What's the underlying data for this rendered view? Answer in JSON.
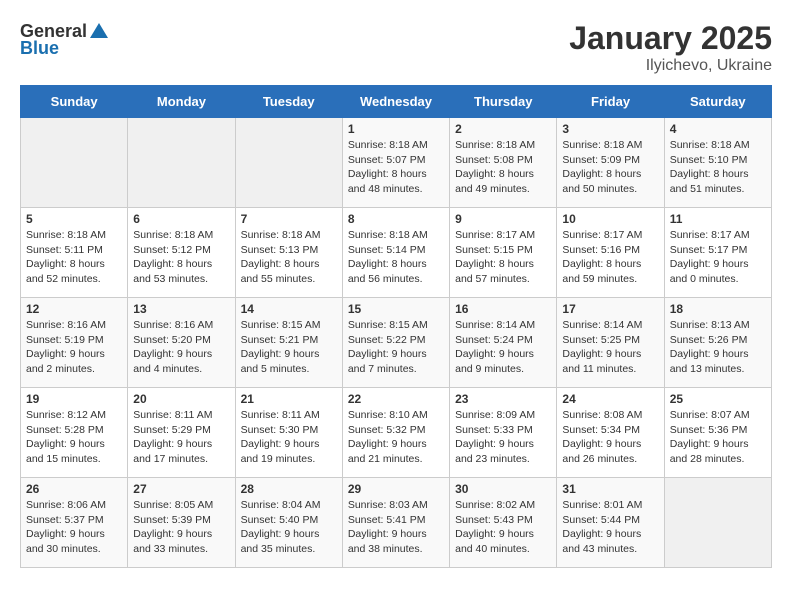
{
  "header": {
    "logo_general": "General",
    "logo_blue": "Blue",
    "title": "January 2025",
    "subtitle": "Ilyichevo, Ukraine"
  },
  "days_of_week": [
    "Sunday",
    "Monday",
    "Tuesday",
    "Wednesday",
    "Thursday",
    "Friday",
    "Saturday"
  ],
  "weeks": [
    [
      {
        "day": "",
        "empty": true
      },
      {
        "day": "",
        "empty": true
      },
      {
        "day": "",
        "empty": true
      },
      {
        "day": "1",
        "sunrise": "8:18 AM",
        "sunset": "5:07 PM",
        "daylight": "8 hours and 48 minutes."
      },
      {
        "day": "2",
        "sunrise": "8:18 AM",
        "sunset": "5:08 PM",
        "daylight": "8 hours and 49 minutes."
      },
      {
        "day": "3",
        "sunrise": "8:18 AM",
        "sunset": "5:09 PM",
        "daylight": "8 hours and 50 minutes."
      },
      {
        "day": "4",
        "sunrise": "8:18 AM",
        "sunset": "5:10 PM",
        "daylight": "8 hours and 51 minutes."
      }
    ],
    [
      {
        "day": "5",
        "sunrise": "8:18 AM",
        "sunset": "5:11 PM",
        "daylight": "8 hours and 52 minutes."
      },
      {
        "day": "6",
        "sunrise": "8:18 AM",
        "sunset": "5:12 PM",
        "daylight": "8 hours and 53 minutes."
      },
      {
        "day": "7",
        "sunrise": "8:18 AM",
        "sunset": "5:13 PM",
        "daylight": "8 hours and 55 minutes."
      },
      {
        "day": "8",
        "sunrise": "8:18 AM",
        "sunset": "5:14 PM",
        "daylight": "8 hours and 56 minutes."
      },
      {
        "day": "9",
        "sunrise": "8:17 AM",
        "sunset": "5:15 PM",
        "daylight": "8 hours and 57 minutes."
      },
      {
        "day": "10",
        "sunrise": "8:17 AM",
        "sunset": "5:16 PM",
        "daylight": "8 hours and 59 minutes."
      },
      {
        "day": "11",
        "sunrise": "8:17 AM",
        "sunset": "5:17 PM",
        "daylight": "9 hours and 0 minutes."
      }
    ],
    [
      {
        "day": "12",
        "sunrise": "8:16 AM",
        "sunset": "5:19 PM",
        "daylight": "9 hours and 2 minutes."
      },
      {
        "day": "13",
        "sunrise": "8:16 AM",
        "sunset": "5:20 PM",
        "daylight": "9 hours and 4 minutes."
      },
      {
        "day": "14",
        "sunrise": "8:15 AM",
        "sunset": "5:21 PM",
        "daylight": "9 hours and 5 minutes."
      },
      {
        "day": "15",
        "sunrise": "8:15 AM",
        "sunset": "5:22 PM",
        "daylight": "9 hours and 7 minutes."
      },
      {
        "day": "16",
        "sunrise": "8:14 AM",
        "sunset": "5:24 PM",
        "daylight": "9 hours and 9 minutes."
      },
      {
        "day": "17",
        "sunrise": "8:14 AM",
        "sunset": "5:25 PM",
        "daylight": "9 hours and 11 minutes."
      },
      {
        "day": "18",
        "sunrise": "8:13 AM",
        "sunset": "5:26 PM",
        "daylight": "9 hours and 13 minutes."
      }
    ],
    [
      {
        "day": "19",
        "sunrise": "8:12 AM",
        "sunset": "5:28 PM",
        "daylight": "9 hours and 15 minutes."
      },
      {
        "day": "20",
        "sunrise": "8:11 AM",
        "sunset": "5:29 PM",
        "daylight": "9 hours and 17 minutes."
      },
      {
        "day": "21",
        "sunrise": "8:11 AM",
        "sunset": "5:30 PM",
        "daylight": "9 hours and 19 minutes."
      },
      {
        "day": "22",
        "sunrise": "8:10 AM",
        "sunset": "5:32 PM",
        "daylight": "9 hours and 21 minutes."
      },
      {
        "day": "23",
        "sunrise": "8:09 AM",
        "sunset": "5:33 PM",
        "daylight": "9 hours and 23 minutes."
      },
      {
        "day": "24",
        "sunrise": "8:08 AM",
        "sunset": "5:34 PM",
        "daylight": "9 hours and 26 minutes."
      },
      {
        "day": "25",
        "sunrise": "8:07 AM",
        "sunset": "5:36 PM",
        "daylight": "9 hours and 28 minutes."
      }
    ],
    [
      {
        "day": "26",
        "sunrise": "8:06 AM",
        "sunset": "5:37 PM",
        "daylight": "9 hours and 30 minutes."
      },
      {
        "day": "27",
        "sunrise": "8:05 AM",
        "sunset": "5:39 PM",
        "daylight": "9 hours and 33 minutes."
      },
      {
        "day": "28",
        "sunrise": "8:04 AM",
        "sunset": "5:40 PM",
        "daylight": "9 hours and 35 minutes."
      },
      {
        "day": "29",
        "sunrise": "8:03 AM",
        "sunset": "5:41 PM",
        "daylight": "9 hours and 38 minutes."
      },
      {
        "day": "30",
        "sunrise": "8:02 AM",
        "sunset": "5:43 PM",
        "daylight": "9 hours and 40 minutes."
      },
      {
        "day": "31",
        "sunrise": "8:01 AM",
        "sunset": "5:44 PM",
        "daylight": "9 hours and 43 minutes."
      },
      {
        "day": "",
        "empty": true
      }
    ]
  ]
}
